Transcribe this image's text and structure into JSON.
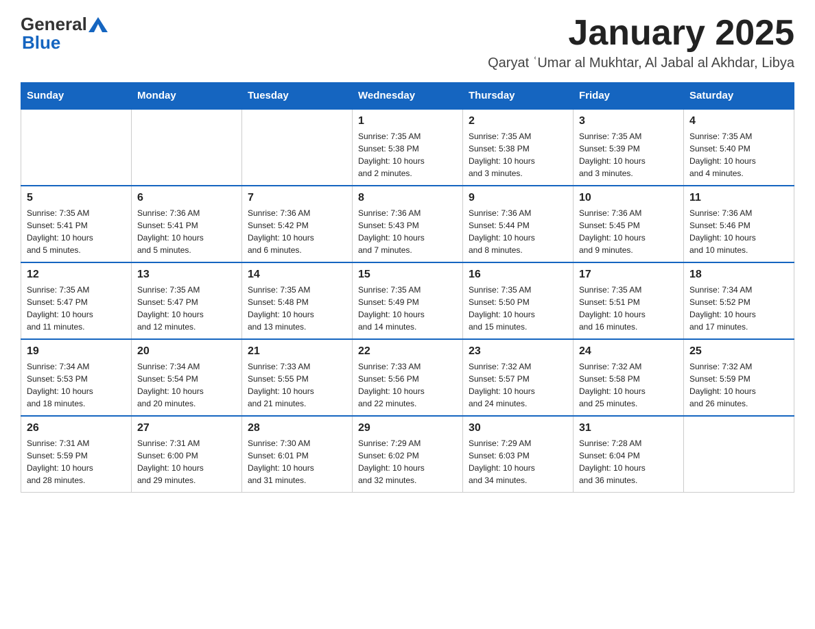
{
  "header": {
    "logo_general": "General",
    "logo_blue": "Blue",
    "month_title": "January 2025",
    "subtitle": "Qaryat ʿUmar al Mukhtar, Al Jabal al Akhdar, Libya"
  },
  "days_of_week": [
    "Sunday",
    "Monday",
    "Tuesday",
    "Wednesday",
    "Thursday",
    "Friday",
    "Saturday"
  ],
  "weeks": [
    {
      "days": [
        {
          "number": "",
          "info": ""
        },
        {
          "number": "",
          "info": ""
        },
        {
          "number": "",
          "info": ""
        },
        {
          "number": "1",
          "info": "Sunrise: 7:35 AM\nSunset: 5:38 PM\nDaylight: 10 hours\nand 2 minutes."
        },
        {
          "number": "2",
          "info": "Sunrise: 7:35 AM\nSunset: 5:38 PM\nDaylight: 10 hours\nand 3 minutes."
        },
        {
          "number": "3",
          "info": "Sunrise: 7:35 AM\nSunset: 5:39 PM\nDaylight: 10 hours\nand 3 minutes."
        },
        {
          "number": "4",
          "info": "Sunrise: 7:35 AM\nSunset: 5:40 PM\nDaylight: 10 hours\nand 4 minutes."
        }
      ]
    },
    {
      "days": [
        {
          "number": "5",
          "info": "Sunrise: 7:35 AM\nSunset: 5:41 PM\nDaylight: 10 hours\nand 5 minutes."
        },
        {
          "number": "6",
          "info": "Sunrise: 7:36 AM\nSunset: 5:41 PM\nDaylight: 10 hours\nand 5 minutes."
        },
        {
          "number": "7",
          "info": "Sunrise: 7:36 AM\nSunset: 5:42 PM\nDaylight: 10 hours\nand 6 minutes."
        },
        {
          "number": "8",
          "info": "Sunrise: 7:36 AM\nSunset: 5:43 PM\nDaylight: 10 hours\nand 7 minutes."
        },
        {
          "number": "9",
          "info": "Sunrise: 7:36 AM\nSunset: 5:44 PM\nDaylight: 10 hours\nand 8 minutes."
        },
        {
          "number": "10",
          "info": "Sunrise: 7:36 AM\nSunset: 5:45 PM\nDaylight: 10 hours\nand 9 minutes."
        },
        {
          "number": "11",
          "info": "Sunrise: 7:36 AM\nSunset: 5:46 PM\nDaylight: 10 hours\nand 10 minutes."
        }
      ]
    },
    {
      "days": [
        {
          "number": "12",
          "info": "Sunrise: 7:35 AM\nSunset: 5:47 PM\nDaylight: 10 hours\nand 11 minutes."
        },
        {
          "number": "13",
          "info": "Sunrise: 7:35 AM\nSunset: 5:47 PM\nDaylight: 10 hours\nand 12 minutes."
        },
        {
          "number": "14",
          "info": "Sunrise: 7:35 AM\nSunset: 5:48 PM\nDaylight: 10 hours\nand 13 minutes."
        },
        {
          "number": "15",
          "info": "Sunrise: 7:35 AM\nSunset: 5:49 PM\nDaylight: 10 hours\nand 14 minutes."
        },
        {
          "number": "16",
          "info": "Sunrise: 7:35 AM\nSunset: 5:50 PM\nDaylight: 10 hours\nand 15 minutes."
        },
        {
          "number": "17",
          "info": "Sunrise: 7:35 AM\nSunset: 5:51 PM\nDaylight: 10 hours\nand 16 minutes."
        },
        {
          "number": "18",
          "info": "Sunrise: 7:34 AM\nSunset: 5:52 PM\nDaylight: 10 hours\nand 17 minutes."
        }
      ]
    },
    {
      "days": [
        {
          "number": "19",
          "info": "Sunrise: 7:34 AM\nSunset: 5:53 PM\nDaylight: 10 hours\nand 18 minutes."
        },
        {
          "number": "20",
          "info": "Sunrise: 7:34 AM\nSunset: 5:54 PM\nDaylight: 10 hours\nand 20 minutes."
        },
        {
          "number": "21",
          "info": "Sunrise: 7:33 AM\nSunset: 5:55 PM\nDaylight: 10 hours\nand 21 minutes."
        },
        {
          "number": "22",
          "info": "Sunrise: 7:33 AM\nSunset: 5:56 PM\nDaylight: 10 hours\nand 22 minutes."
        },
        {
          "number": "23",
          "info": "Sunrise: 7:32 AM\nSunset: 5:57 PM\nDaylight: 10 hours\nand 24 minutes."
        },
        {
          "number": "24",
          "info": "Sunrise: 7:32 AM\nSunset: 5:58 PM\nDaylight: 10 hours\nand 25 minutes."
        },
        {
          "number": "25",
          "info": "Sunrise: 7:32 AM\nSunset: 5:59 PM\nDaylight: 10 hours\nand 26 minutes."
        }
      ]
    },
    {
      "days": [
        {
          "number": "26",
          "info": "Sunrise: 7:31 AM\nSunset: 5:59 PM\nDaylight: 10 hours\nand 28 minutes."
        },
        {
          "number": "27",
          "info": "Sunrise: 7:31 AM\nSunset: 6:00 PM\nDaylight: 10 hours\nand 29 minutes."
        },
        {
          "number": "28",
          "info": "Sunrise: 7:30 AM\nSunset: 6:01 PM\nDaylight: 10 hours\nand 31 minutes."
        },
        {
          "number": "29",
          "info": "Sunrise: 7:29 AM\nSunset: 6:02 PM\nDaylight: 10 hours\nand 32 minutes."
        },
        {
          "number": "30",
          "info": "Sunrise: 7:29 AM\nSunset: 6:03 PM\nDaylight: 10 hours\nand 34 minutes."
        },
        {
          "number": "31",
          "info": "Sunrise: 7:28 AM\nSunset: 6:04 PM\nDaylight: 10 hours\nand 36 minutes."
        },
        {
          "number": "",
          "info": ""
        }
      ]
    }
  ]
}
